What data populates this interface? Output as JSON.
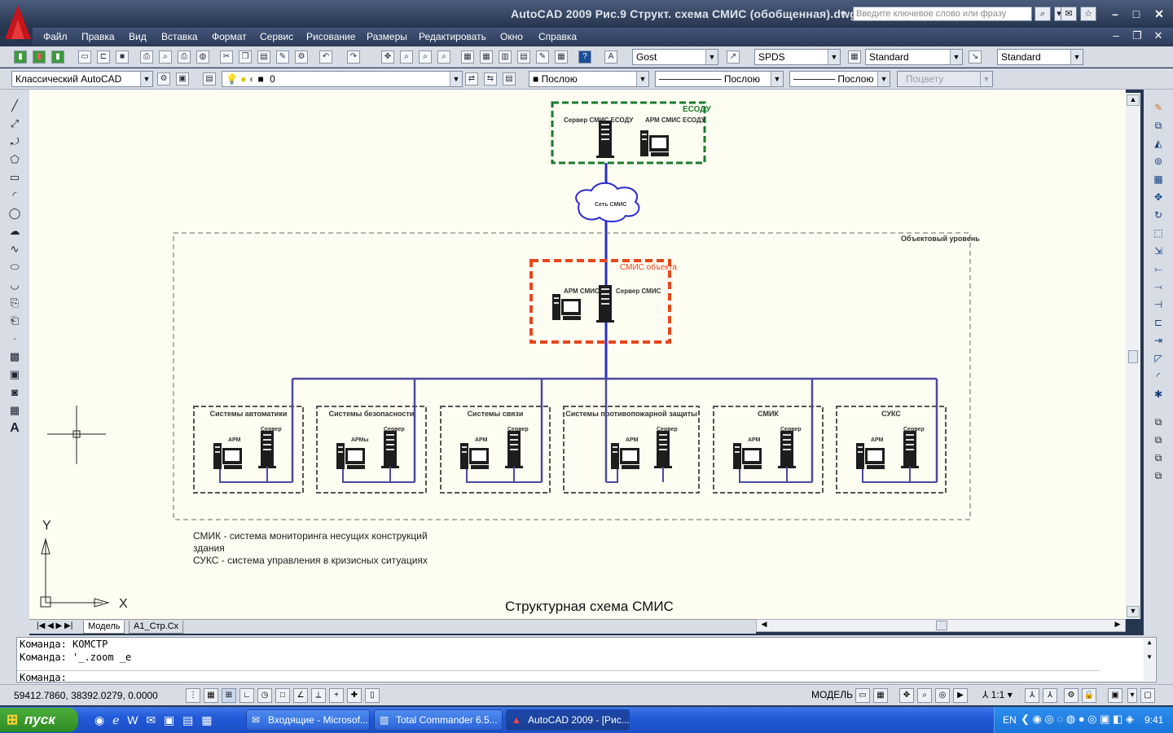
{
  "window": {
    "title": "AutoCAD 2009 Рис.9 Структ. схема СМИС (обобщенная).dwg",
    "search_placeholder": "Введите ключевое слово или фразу"
  },
  "menu": [
    "Файл",
    "Правка",
    "Вид",
    "Вставка",
    "Формат",
    "Сервис",
    "Рисование",
    "Размеры",
    "Редактировать",
    "Окно",
    "Справка"
  ],
  "toolbar": {
    "text_style": "Gost",
    "dim_style": "SPDS",
    "table_style": "Standard",
    "mleader_style": "Standard",
    "workspace": "Классический AutoCAD",
    "layer": "0",
    "color": "Послою",
    "linetype": "Послою",
    "lineweight": "Послою",
    "plotstyle": "Поцвету"
  },
  "drawing": {
    "esodu_group": "ЕСОДУ",
    "esodu_server": "Сервер СМИС ЕСОДУ",
    "esodu_arm": "АРМ СМИС ЕСОДУ",
    "network": "Сеть СМИС",
    "object_level": "Объектовый уровень",
    "smis_object": "СМИС объекта",
    "smis_arm": "АРМ СМИС",
    "smis_server": "Сервер СМИС",
    "subsystems": [
      {
        "title": "Системы автоматики",
        "arm": "АРМ",
        "server": "Сервер"
      },
      {
        "title": "Системы безопасности",
        "arm": "АРМы",
        "server": "Сервер"
      },
      {
        "title": "Системы связи",
        "arm": "АРМ",
        "server": "Сервер"
      },
      {
        "title": "Системы противопожарной защиты",
        "arm": "АРМ",
        "server": "Сервер"
      },
      {
        "title": "СМИК",
        "arm": "АРМ",
        "server": "Сервер"
      },
      {
        "title": "СУКС",
        "arm": "АРМ",
        "server": "Сервер"
      }
    ],
    "legend": [
      "СМИК - система мониторинга несущих конструкций",
      "здания",
      "СУКС - система управления в кризисных ситуациях"
    ],
    "caption": "Структурная схема СМИС",
    "ucs_x": "X",
    "ucs_y": "Y"
  },
  "tabs": [
    "Модель",
    "А1_Стр.Сх"
  ],
  "command": {
    "line1": "Команда: КОМСТР",
    "line2": "Команда: '_.zoom _e",
    "prompt": "Команда:"
  },
  "status": {
    "coords": "59412.7860, 38392.0279, 0.0000",
    "space": "МОДЕЛЬ",
    "scale": "1:1"
  },
  "taskbar": {
    "start": "пуск",
    "tasks": [
      "Входящие - Microsof...",
      "Total Commander 6.5...",
      "AutoCAD 2009 - [Рис..."
    ],
    "lang": "EN",
    "clock": "9:41"
  }
}
